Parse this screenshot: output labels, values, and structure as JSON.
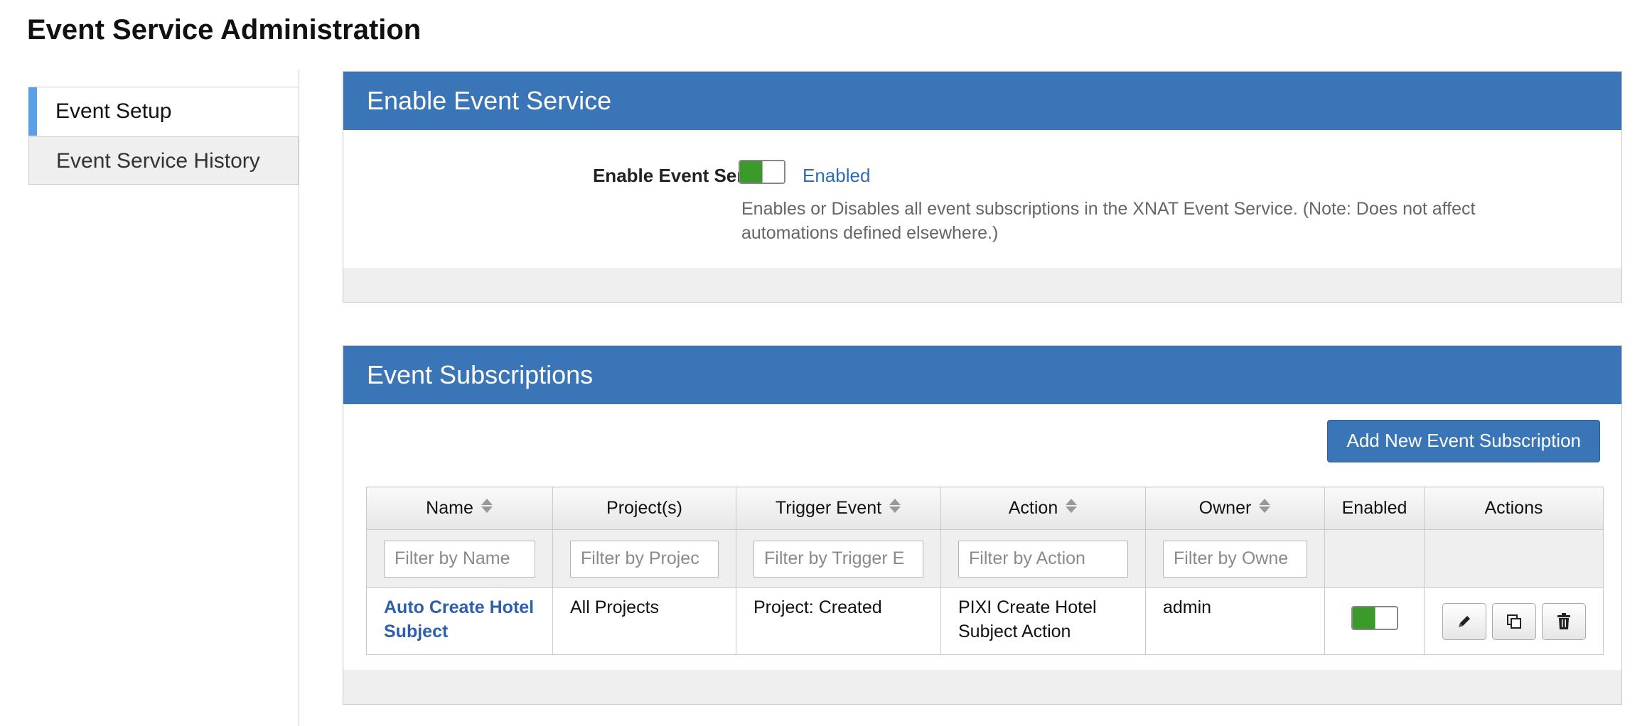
{
  "page": {
    "title": "Event Service Administration"
  },
  "sidebar": {
    "items": [
      {
        "label": "Event Setup",
        "active": true
      },
      {
        "label": "Event Service History",
        "active": false
      }
    ]
  },
  "enable_panel": {
    "header": "Enable Event Service",
    "field_label": "Enable Event Service",
    "toggle_state": "on",
    "status_text": "Enabled",
    "description": "Enables or Disables all event subscriptions in the XNAT Event Service. (Note: Does not affect automations defined elsewhere.)"
  },
  "subscriptions_panel": {
    "header": "Event Subscriptions",
    "add_button": "Add New Event Subscription",
    "columns": [
      "Name",
      "Project(s)",
      "Trigger Event",
      "Action",
      "Owner",
      "Enabled",
      "Actions"
    ],
    "filters": {
      "name": "Filter by Name",
      "projects": "Filter by Projec",
      "trigger": "Filter by Trigger E",
      "action": "Filter by Action",
      "owner": "Filter by Owne"
    },
    "rows": [
      {
        "name": "Auto Create Hotel Subject",
        "projects": "All Projects",
        "trigger": "Project: Created",
        "action": "PIXI Create Hotel Subject Action",
        "owner": "admin",
        "enabled": "on"
      }
    ]
  },
  "colors": {
    "header_blue": "#3975b7",
    "link_blue": "#2d5fb0",
    "toggle_green": "#3a9a2a",
    "sidebar_accent": "#5aa0e6"
  },
  "icons": {
    "edit": "pencil-icon",
    "copy": "copy-icon",
    "delete": "trash-icon",
    "sort": "sort-arrows-icon"
  }
}
